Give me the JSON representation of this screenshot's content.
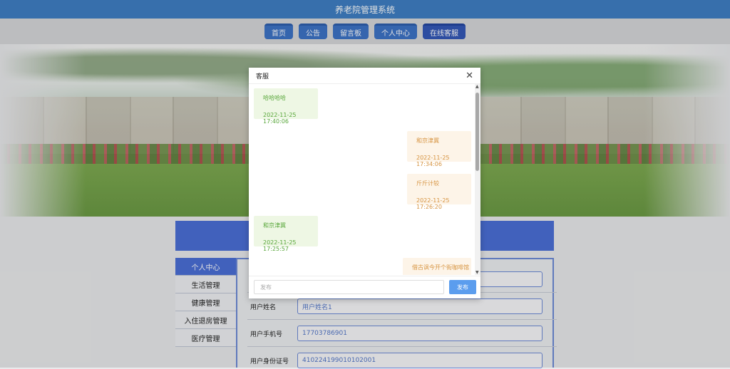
{
  "app": {
    "title": "养老院管理系统"
  },
  "nav": {
    "items": [
      {
        "label": "首页"
      },
      {
        "label": "公告"
      },
      {
        "label": "留言板"
      },
      {
        "label": "个人中心"
      },
      {
        "label": "在线客服"
      }
    ]
  },
  "sidebar": {
    "items": [
      {
        "label": "个人中心"
      },
      {
        "label": "生活管理"
      },
      {
        "label": "健康管理"
      },
      {
        "label": "入住退房管理"
      },
      {
        "label": "医疗管理"
      }
    ]
  },
  "form": {
    "rows": [
      {
        "label": "用户姓名",
        "value": "用户姓名1"
      },
      {
        "label": "用户手机号",
        "value": "17703786901"
      },
      {
        "label": "用户身份证号",
        "value": "410224199010102001"
      }
    ]
  },
  "dialog": {
    "title": "客服",
    "messages": [
      {
        "side": "left",
        "text": "哈哈哈哈",
        "time": "2022-11-25 17:40:06"
      },
      {
        "side": "right",
        "text": "和京津冀",
        "time": "2022-11-25 17:34:06"
      },
      {
        "side": "right",
        "text": "斤斤计较",
        "time": "2022-11-25 17:26:20"
      },
      {
        "side": "left",
        "text": "和京津冀",
        "time": "2022-11-25 17:25:57"
      },
      {
        "side": "right",
        "text": "借古讽今开个街咖啡馆",
        "time": ""
      }
    ],
    "input_placeholder": "发布",
    "send_label": "发布"
  }
}
